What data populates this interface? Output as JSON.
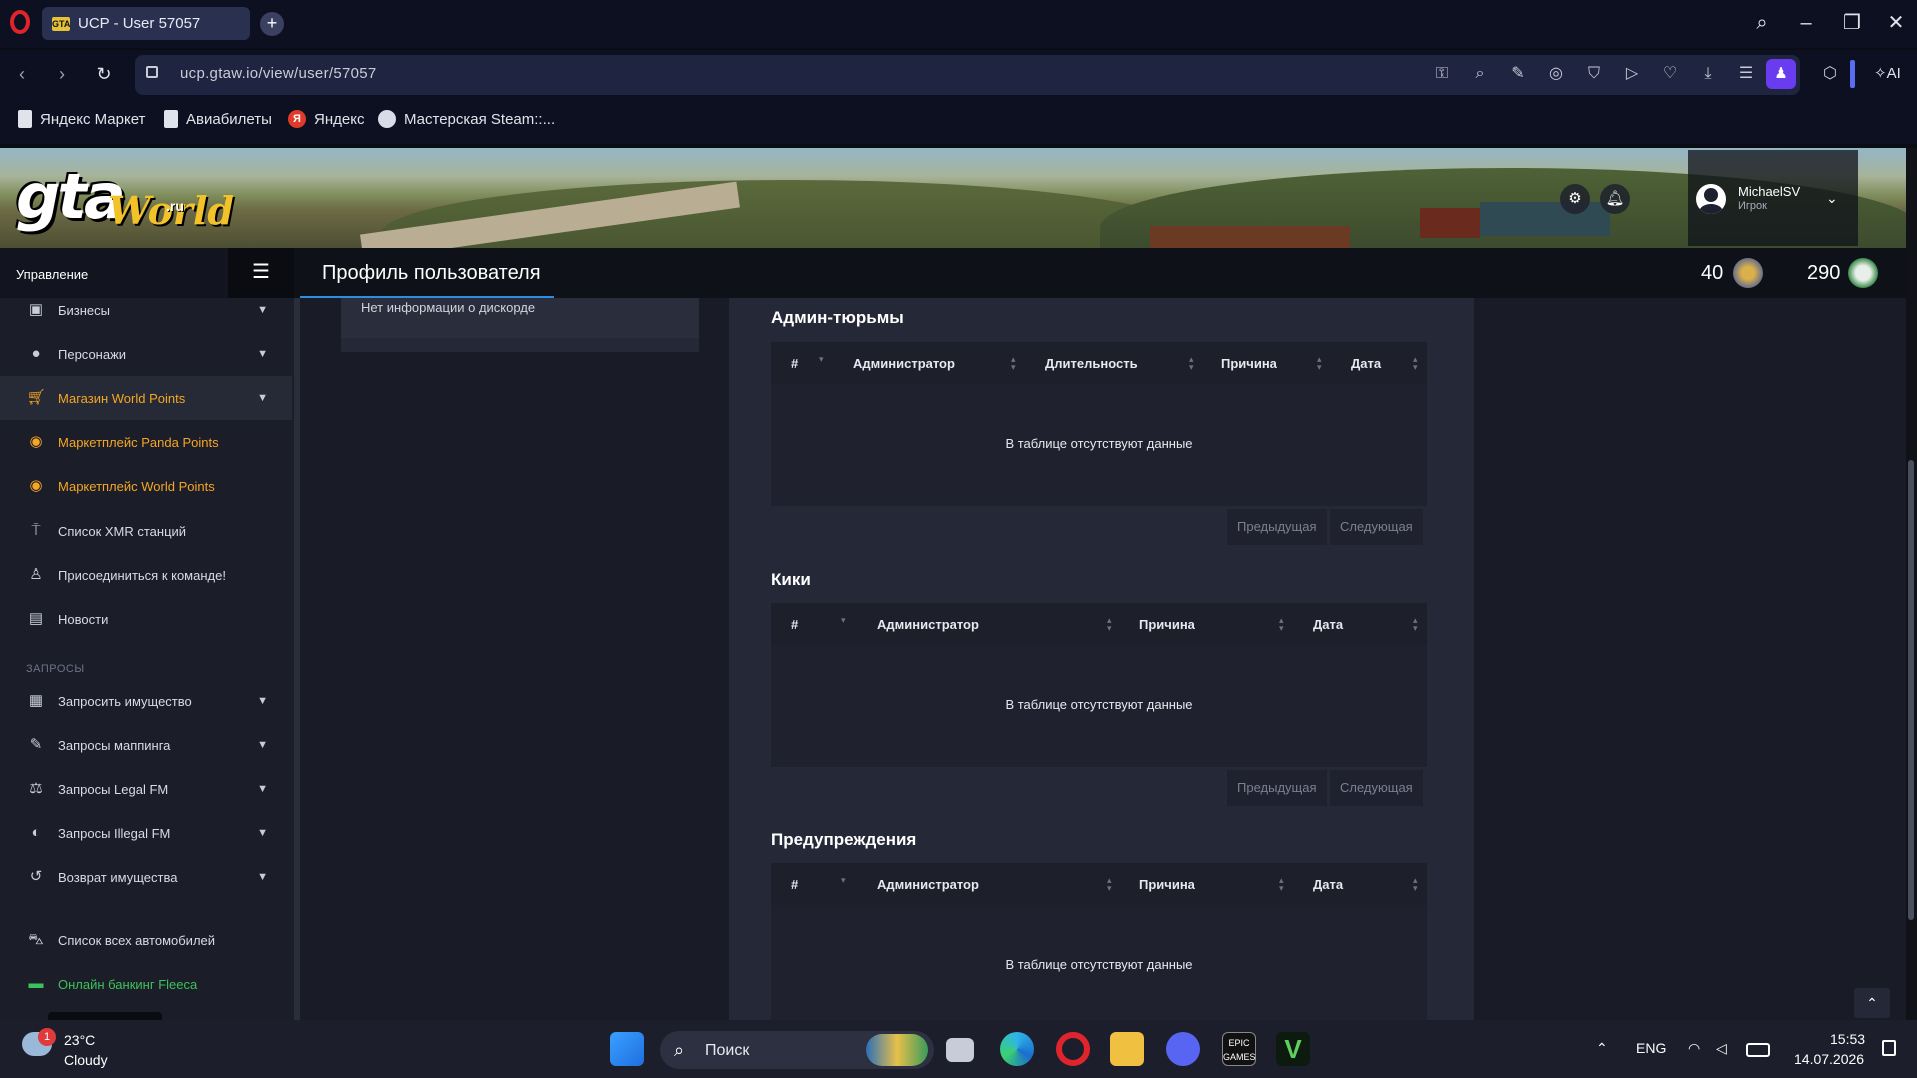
{
  "browser": {
    "tab_title": "UCP - User 57057",
    "url": "ucp.gtaw.io/view/user/57057",
    "bookmarks": [
      "Яндекс Маркет",
      "Авиабилеты",
      "Яндекс",
      "Мастерская Steam::..."
    ],
    "ai_label": "AI"
  },
  "header": {
    "logo_gta": "gta",
    "logo_world": "World",
    "logo_ru": ".ru",
    "user_name": "MichaelSV",
    "user_role": "Игрок"
  },
  "titlebar": {
    "sidebar_heading": "Управление",
    "page_title": "Профиль пользователя",
    "stat1": "40",
    "stat2": "290"
  },
  "sidebar": {
    "items": [
      {
        "label": "Бизнесы",
        "icon": "briefcase-icon",
        "chevron": true
      },
      {
        "label": "Персонажи",
        "icon": "person-icon",
        "chevron": true
      },
      {
        "label": "Магазин World Points",
        "icon": "cart-icon",
        "chevron": true
      },
      {
        "label": "Маркетплейс Panda Points",
        "icon": "coins-icon",
        "chevron": false
      },
      {
        "label": "Маркетплейс World Points",
        "icon": "coins-icon",
        "chevron": false
      },
      {
        "label": "Список XMR станций",
        "icon": "antenna-icon",
        "chevron": false
      },
      {
        "label": "Присоединиться к команде!",
        "icon": "user-plus-icon",
        "chevron": false
      },
      {
        "label": "Новости",
        "icon": "newspaper-icon",
        "chevron": false
      }
    ],
    "section_label": "ЗАПРОСЫ",
    "request_items": [
      {
        "label": "Запросить имущество",
        "icon": "building-icon",
        "chevron": true
      },
      {
        "label": "Запросы маппинга",
        "icon": "brush-icon",
        "chevron": true
      },
      {
        "label": "Запросы Legal FM",
        "icon": "scales-icon",
        "chevron": true
      },
      {
        "label": "Запросы Illegal FM",
        "icon": "mask-icon",
        "chevron": true
      },
      {
        "label": "Возврат имущества",
        "icon": "undo-icon",
        "chevron": true
      }
    ],
    "bottom_items": [
      {
        "label": "Список всех автомобилей",
        "icon": "car-icon"
      },
      {
        "label": "Онлайн банкинг Fleeca",
        "icon": "bank-card-icon"
      }
    ]
  },
  "left_card": {
    "text": "Нет информации о дискорде"
  },
  "sections": {
    "jails": {
      "title": "Админ-тюрьмы",
      "columns": [
        "#",
        "Администратор",
        "Длительность",
        "Причина",
        "Дата"
      ],
      "empty": "В таблице отсутствуют данные",
      "prev": "Предыдущая",
      "next": "Следующая"
    },
    "kicks": {
      "title": "Кики",
      "columns": [
        "#",
        "Администратор",
        "Причина",
        "Дата"
      ],
      "empty": "В таблице отсутствуют данные",
      "prev": "Предыдущая",
      "next": "Следующая"
    },
    "warnings": {
      "title": "Предупреждения",
      "columns": [
        "#",
        "Администратор",
        "Причина",
        "Дата"
      ],
      "empty": "В таблице отсутствуют данные"
    }
  },
  "taskbar": {
    "temp": "23°C",
    "weather": "Cloudy",
    "weather_badge": "1",
    "search": "Поиск",
    "lang": "ENG",
    "time": "15:53",
    "date": "14.07.2026"
  },
  "colors": {
    "accent_blue": "#2d8ee0",
    "gold": "#f5a623",
    "green": "#3cc25a"
  }
}
